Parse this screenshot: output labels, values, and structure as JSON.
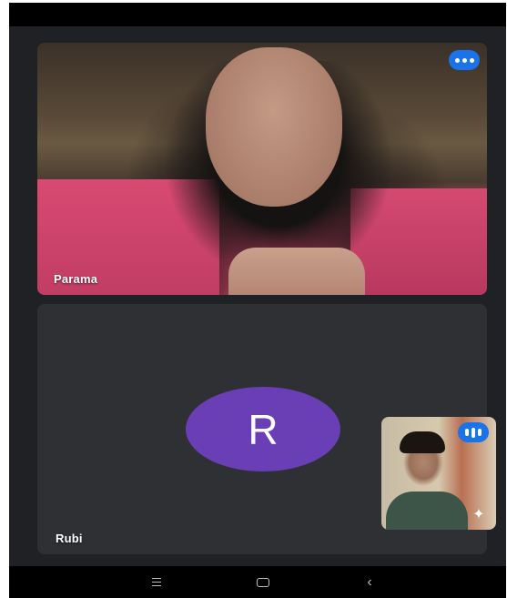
{
  "participants": {
    "main": {
      "name": "Parama",
      "more_icon": "more-options-icon"
    },
    "second": {
      "name": "Rubi",
      "avatar_initial": "R",
      "avatar_color": "#6a3fb5"
    },
    "self": {
      "more_icon": "more-options-icon",
      "effects_icon": "sparkle-effects-icon"
    }
  },
  "colors": {
    "background": "#202124",
    "tile": "#2f3033",
    "accent": "#1a73e8"
  },
  "nav": {
    "recents_icon": "recents-icon",
    "home_icon": "home-icon",
    "back_icon": "back-icon"
  }
}
